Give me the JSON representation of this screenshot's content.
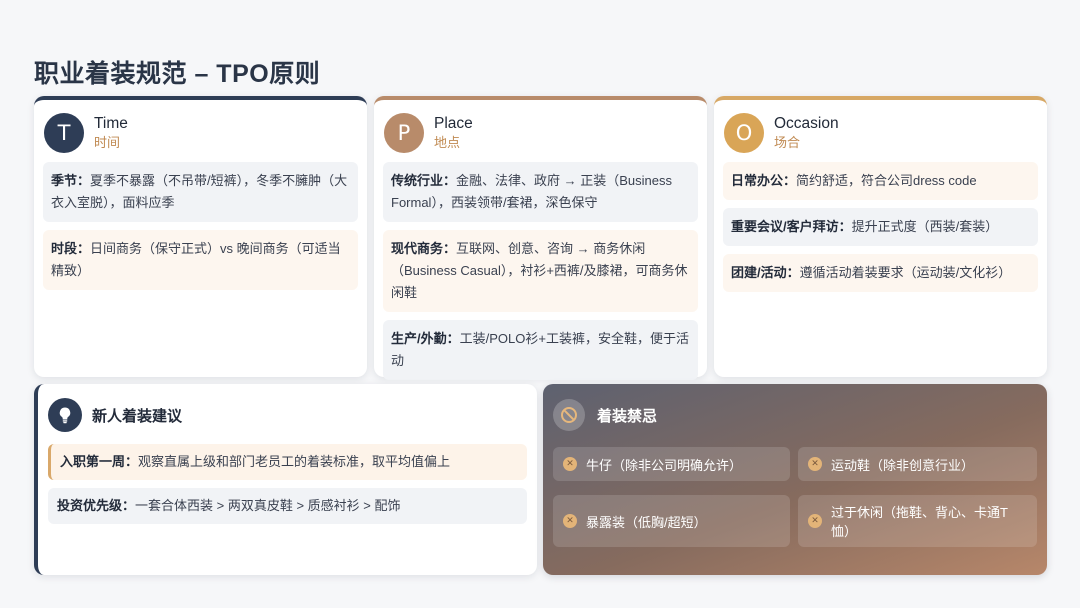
{
  "page": {
    "title": "职业着装规范 – TPO原则"
  },
  "cards": {
    "time": {
      "letter": "T",
      "title": "Time",
      "subtitle": "时间",
      "items": [
        {
          "label": "季节：",
          "text": "夏季不暴露（不吊带/短裤），冬季不臃肿（大衣入室脱），面料应季"
        },
        {
          "label": "时段：",
          "text": "日间商务（保守正式）vs 晚间商务（可适当精致）"
        }
      ]
    },
    "place": {
      "letter": "P",
      "title": "Place",
      "subtitle": "地点",
      "items": [
        {
          "label": "传统行业：",
          "text": "金融、法律、政府 → 正装（Business Formal），西装领带/套裙，深色保守"
        },
        {
          "label": "现代商务：",
          "text": "互联网、创意、咨询 → 商务休闲（Business Casual），衬衫+西裤/及膝裙，可商务休闲鞋"
        },
        {
          "label": "生产/外勤：",
          "text": "工装/POLO衫+工装裤，安全鞋，便于活动"
        }
      ]
    },
    "occasion": {
      "letter": "O",
      "title": "Occasion",
      "subtitle": "场合",
      "items": [
        {
          "label": "日常办公：",
          "text": "简约舒适，符合公司dress code"
        },
        {
          "label": "重要会议/客户拜访：",
          "text": "提升正式度（西装/套装）"
        },
        {
          "label": "团建/活动：",
          "text": "遵循活动着装要求（运动装/文化衫）"
        }
      ]
    }
  },
  "advice": {
    "title": "新人着装建议",
    "icon": "lightbulb-icon",
    "items": [
      {
        "label": "入职第一周：",
        "text": "观察直属上级和部门老员工的着装标准，取平均值偏上"
      },
      {
        "label": "投资优先级：",
        "text": "一套合体西装 > 两双真皮鞋 > 质感衬衫 > 配饰"
      }
    ]
  },
  "taboo": {
    "title": "着装禁忌",
    "icon": "prohibited-icon",
    "items": [
      "牛仔（除非公司明确允许）",
      "运动鞋（除非创意行业）",
      "暴露装（低胸/超短）",
      "过于休闲（拖鞋、背心、卡通T恤）"
    ]
  },
  "colors": {
    "navy": "#2e3d56",
    "brown": "#b88b6a",
    "gold": "#d9a557",
    "cream": "#fdf6ef"
  }
}
